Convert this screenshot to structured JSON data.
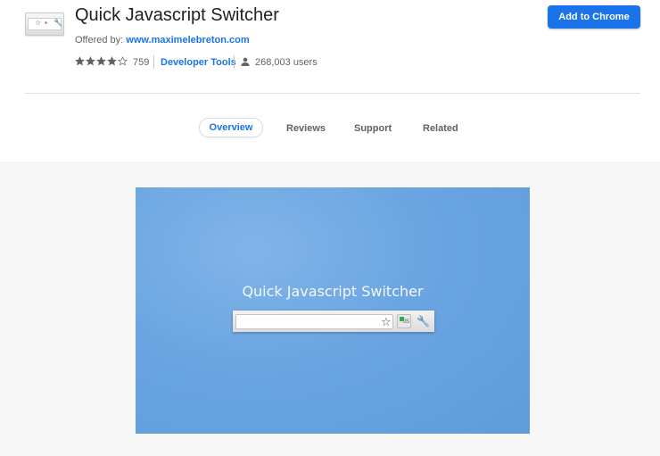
{
  "extension": {
    "name": "Quick Javascript Switcher",
    "offered_by_label": "Offered by:",
    "offered_by_link": "www.maximelebreton.com",
    "rating": 4,
    "rating_count": "759",
    "category": "Developer Tools",
    "users": "268,003 users",
    "icon": "extension-toolbar-icon"
  },
  "actions": {
    "add_label": "Add to Chrome",
    "accent_color": "#1a73e8"
  },
  "tabs": [
    {
      "label": "Overview",
      "active": true
    },
    {
      "label": "Reviews",
      "active": false
    },
    {
      "label": "Support",
      "active": false
    },
    {
      "label": "Related",
      "active": false
    }
  ],
  "gallery": {
    "screenshot_title": "Quick Javascript Switcher",
    "icons": [
      "star-icon",
      "javascript-toggle-icon",
      "wrench-icon"
    ]
  }
}
